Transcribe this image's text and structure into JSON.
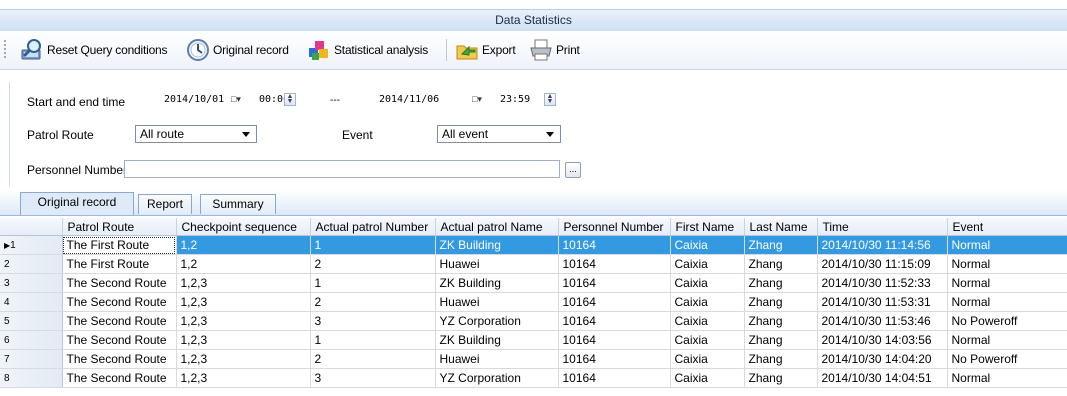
{
  "window": {
    "title": "Data Statistics"
  },
  "toolbar": {
    "reset_label": "Reset Query conditions",
    "original_label": "Original record",
    "stats_label": "Statistical analysis",
    "export_label": "Export",
    "print_label": "Print"
  },
  "filter": {
    "time_label": "Start and end time",
    "start_date": "2014/10/01",
    "start_time": "00:00",
    "range_sep": "---",
    "end_date": "2014/11/06",
    "end_time": "23:59",
    "route_label": "Patrol Route",
    "route_value": "All route",
    "event_label": "Event",
    "event_value": "All event",
    "personnel_label": "Personnel Number",
    "personnel_value": "",
    "browse_label": "..."
  },
  "tabs": [
    "Original record",
    "Report",
    "Summary"
  ],
  "table": {
    "columns": [
      "Patrol Route",
      "Checkpoint sequence",
      "Actual patrol Number",
      "Actual patrol Name",
      "Personnel Number",
      "First Name",
      "Last Name",
      "Time",
      "Event"
    ],
    "rows": [
      {
        "n": "1",
        "route": "The First Route",
        "seq": "1,2",
        "num": "1",
        "name": "ZK Building",
        "pers": "10164",
        "first": "Caixia",
        "last": "Zhang",
        "time": "2014/10/30 11:14:56",
        "event": "Normal"
      },
      {
        "n": "2",
        "route": "The First Route",
        "seq": "1,2",
        "num": "2",
        "name": "Huawei",
        "pers": "10164",
        "first": "Caixia",
        "last": "Zhang",
        "time": "2014/10/30 11:15:09",
        "event": "Normal"
      },
      {
        "n": "3",
        "route": "The Second Route",
        "seq": "1,2,3",
        "num": "1",
        "name": "ZK Building",
        "pers": "10164",
        "first": "Caixia",
        "last": "Zhang",
        "time": "2014/10/30 11:52:33",
        "event": "Normal"
      },
      {
        "n": "4",
        "route": "The Second Route",
        "seq": "1,2,3",
        "num": "2",
        "name": "Huawei",
        "pers": "10164",
        "first": "Caixia",
        "last": "Zhang",
        "time": "2014/10/30 11:53:31",
        "event": "Normal"
      },
      {
        "n": "5",
        "route": "The Second Route",
        "seq": "1,2,3",
        "num": "3",
        "name": "YZ Corporation",
        "pers": "10164",
        "first": "Caixia",
        "last": "Zhang",
        "time": "2014/10/30 11:53:46",
        "event": "No Poweroff"
      },
      {
        "n": "6",
        "route": "The Second Route",
        "seq": "1,2,3",
        "num": "1",
        "name": "ZK Building",
        "pers": "10164",
        "first": "Caixia",
        "last": "Zhang",
        "time": "2014/10/30 14:03:56",
        "event": "Normal"
      },
      {
        "n": "7",
        "route": "The Second Route",
        "seq": "1,2,3",
        "num": "2",
        "name": "Huawei",
        "pers": "10164",
        "first": "Caixia",
        "last": "Zhang",
        "time": "2014/10/30 14:04:20",
        "event": "No Poweroff"
      },
      {
        "n": "8",
        "route": "The Second Route",
        "seq": "1,2,3",
        "num": "3",
        "name": "YZ Corporation",
        "pers": "10164",
        "first": "Caixia",
        "last": "Zhang",
        "time": "2014/10/30 14:04:51",
        "event": "Normal"
      }
    ]
  },
  "colors": {
    "selection": "#3399e0",
    "header": "#dce8f7"
  }
}
